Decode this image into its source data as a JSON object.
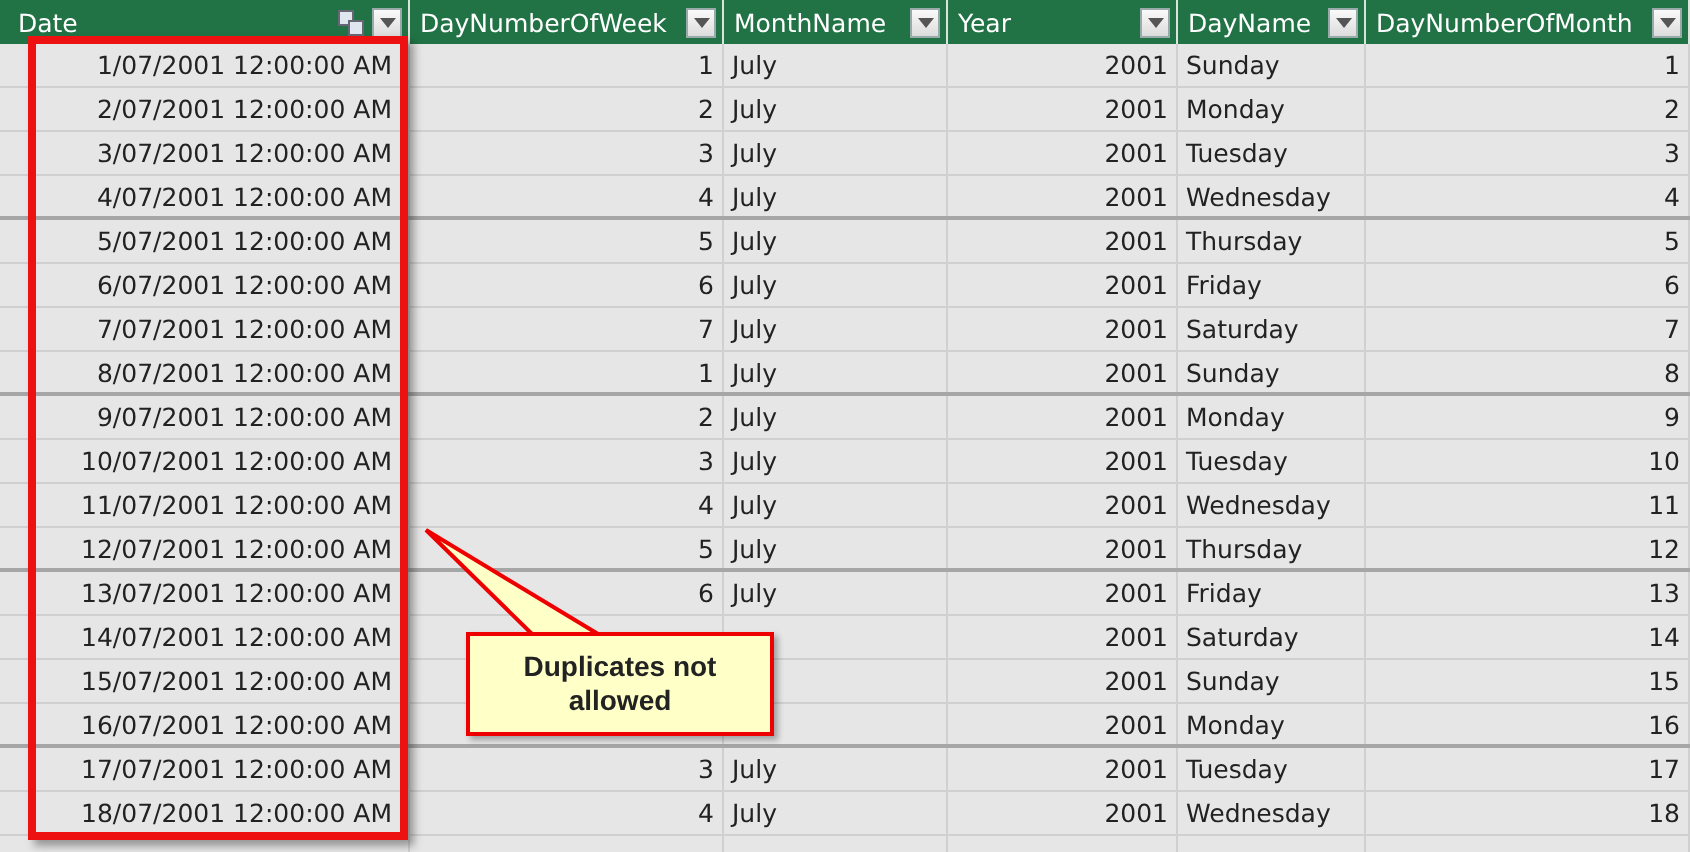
{
  "table": {
    "columns": [
      {
        "label": "Date",
        "kind": "date"
      },
      {
        "label": "DayNumberOfWeek",
        "kind": "number"
      },
      {
        "label": "MonthName",
        "kind": "text"
      },
      {
        "label": "Year",
        "kind": "number"
      },
      {
        "label": "DayName",
        "kind": "text"
      },
      {
        "label": "DayNumberOfMonth",
        "kind": "number"
      }
    ],
    "rows": [
      [
        "1/07/2001 12:00:00 AM",
        "1",
        "July",
        "2001",
        "Sunday",
        "1"
      ],
      [
        "2/07/2001 12:00:00 AM",
        "2",
        "July",
        "2001",
        "Monday",
        "2"
      ],
      [
        "3/07/2001 12:00:00 AM",
        "3",
        "July",
        "2001",
        "Tuesday",
        "3"
      ],
      [
        "4/07/2001 12:00:00 AM",
        "4",
        "July",
        "2001",
        "Wednesday",
        "4"
      ],
      [
        "5/07/2001 12:00:00 AM",
        "5",
        "July",
        "2001",
        "Thursday",
        "5"
      ],
      [
        "6/07/2001 12:00:00 AM",
        "6",
        "July",
        "2001",
        "Friday",
        "6"
      ],
      [
        "7/07/2001 12:00:00 AM",
        "7",
        "July",
        "2001",
        "Saturday",
        "7"
      ],
      [
        "8/07/2001 12:00:00 AM",
        "1",
        "July",
        "2001",
        "Sunday",
        "8"
      ],
      [
        "9/07/2001 12:00:00 AM",
        "2",
        "July",
        "2001",
        "Monday",
        "9"
      ],
      [
        "10/07/2001 12:00:00 AM",
        "3",
        "July",
        "2001",
        "Tuesday",
        "10"
      ],
      [
        "11/07/2001 12:00:00 AM",
        "4",
        "July",
        "2001",
        "Wednesday",
        "11"
      ],
      [
        "12/07/2001 12:00:00 AM",
        "5",
        "July",
        "2001",
        "Thursday",
        "12"
      ],
      [
        "13/07/2001 12:00:00 AM",
        "6",
        "July",
        "2001",
        "Friday",
        "13"
      ],
      [
        "14/07/2001 12:00:00 AM",
        null,
        null,
        "2001",
        "Saturday",
        "14"
      ],
      [
        "15/07/2001 12:00:00 AM",
        null,
        null,
        "2001",
        "Sunday",
        "15"
      ],
      [
        "16/07/2001 12:00:00 AM",
        null,
        null,
        "2001",
        "Monday",
        "16"
      ],
      [
        "17/07/2001 12:00:00 AM",
        "3",
        "July",
        "2001",
        "Tuesday",
        "17"
      ],
      [
        "18/07/2001 12:00:00 AM",
        "4",
        "July",
        "2001",
        "Wednesday",
        "18"
      ]
    ]
  },
  "callout": {
    "text": "Duplicates not allowed"
  }
}
